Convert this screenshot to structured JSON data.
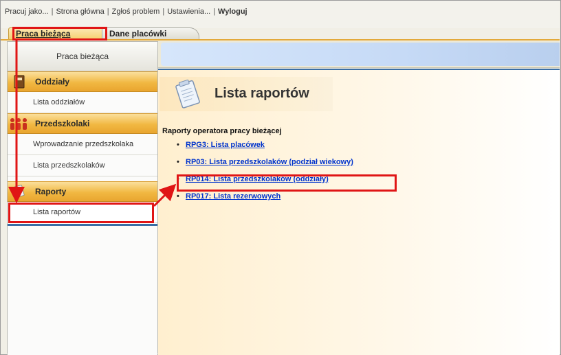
{
  "topnav": {
    "links": [
      "Pracuj jako...",
      "Strona główna",
      "Zgłoś problem",
      "Ustawienia...",
      "Wyloguj"
    ],
    "separator": "|"
  },
  "tabs": [
    {
      "label": "Praca bieżąca",
      "active": true
    },
    {
      "label": "Dane placówki",
      "active": false
    }
  ],
  "sidebar": {
    "title": "Praca bieżąca",
    "groups": [
      {
        "label": "Oddziały",
        "icon": "notebook-icon",
        "items": [
          "Lista oddziałów"
        ]
      },
      {
        "label": "Przedszkolaki",
        "icon": "people-icon",
        "items": [
          "Wprowadzanie przedszkolaka",
          "Lista przedszkolaków"
        ]
      },
      {
        "label": "Raporty",
        "icon": "reports-icon",
        "items": [
          "Lista raportów"
        ]
      }
    ]
  },
  "main": {
    "title": "Lista raportów",
    "section_header": "Raporty operatora pracy bieżącej",
    "reports": [
      "RPG3: Lista placówek",
      "RP03: Lista przedszkolaków (podział wiekowy)",
      "RP014: Lista przedszkolaków (oddziały)",
      "RP017: Lista rezerwowych"
    ]
  },
  "colors": {
    "accent_orange": "#f1b842",
    "link_blue": "#0033cc",
    "highlight_red": "#e01515",
    "selection_blue": "#3a6ea5"
  }
}
